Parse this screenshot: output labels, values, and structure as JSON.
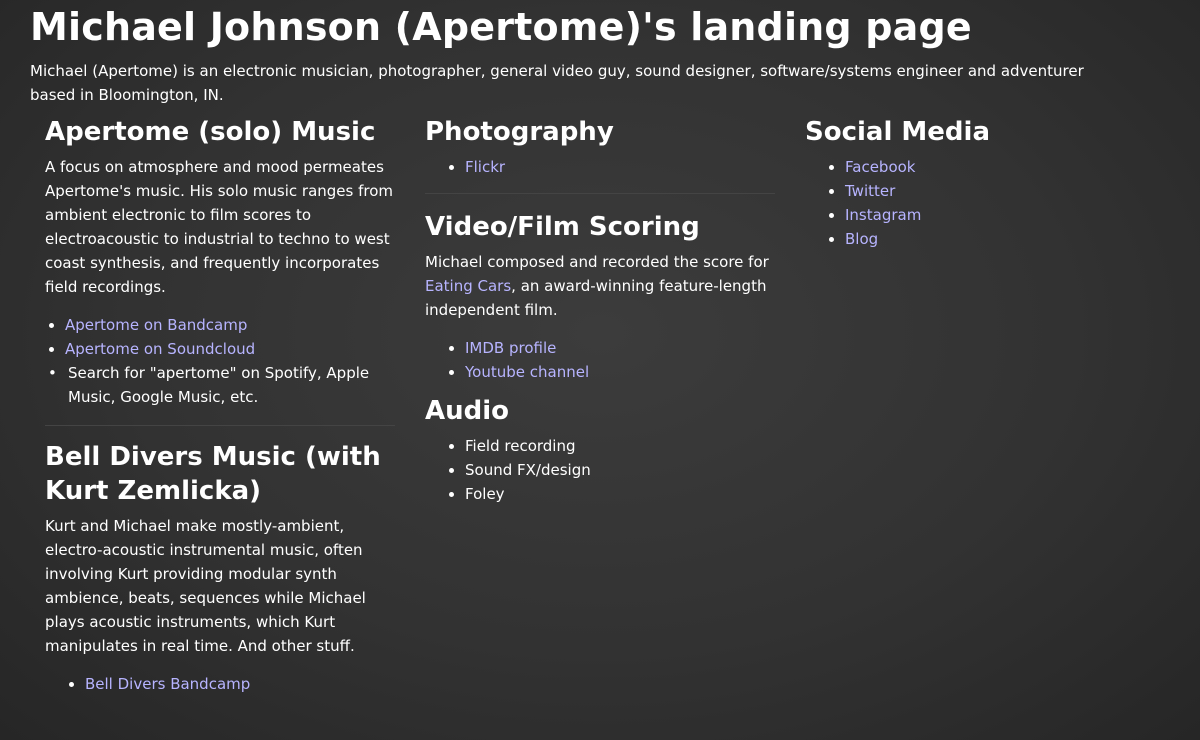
{
  "page": {
    "title": "Michael Johnson (Apertome)'s landing page",
    "intro": "Michael (Apertome) is an electronic musician, photographer, general video guy, sound designer, software/systems engineer and adventurer based in Bloomington, IN."
  },
  "solo": {
    "heading": "Apertome (solo) Music",
    "text": "A focus on atmosphere and mood permeates Apertome's music. His solo music ranges from ambient electronic to film scores to electroacoustic to industrial to techno to west coast synthesis, and frequently incorporates field recordings.",
    "links": [
      "Apertome on Bandcamp",
      "Apertome on Soundcloud"
    ],
    "search_note": "Search for \"apertome\" on Spotify, Apple Music, Google Music, etc."
  },
  "bell": {
    "heading": "Bell Divers Music (with Kurt Zemlicka)",
    "text": "Kurt and Michael make mostly-ambient, electro-acoustic instrumental music, often involving Kurt providing modular synth ambience, beats, sequences while Michael plays acoustic instruments, which Kurt manipulates in real time. And other stuff.",
    "link": "Bell Divers Bandcamp"
  },
  "photo": {
    "heading": "Photography",
    "link": "Flickr"
  },
  "video": {
    "heading": "Video/Film Scoring",
    "text_before": "Michael composed and recorded the score for ",
    "film_link": "Eating Cars",
    "text_after": ", an award-winning feature-length independent film.",
    "links": [
      "IMDB profile",
      "Youtube channel"
    ]
  },
  "audio": {
    "heading": "Audio",
    "items": [
      "Field recording",
      "Sound FX/design",
      "Foley"
    ]
  },
  "social": {
    "heading": "Social Media",
    "links": [
      "Facebook",
      "Twitter",
      "Instagram",
      "Blog"
    ]
  },
  "colors": {
    "link": "#b7b4ff",
    "text": "#ffffff",
    "background": "#333333"
  }
}
